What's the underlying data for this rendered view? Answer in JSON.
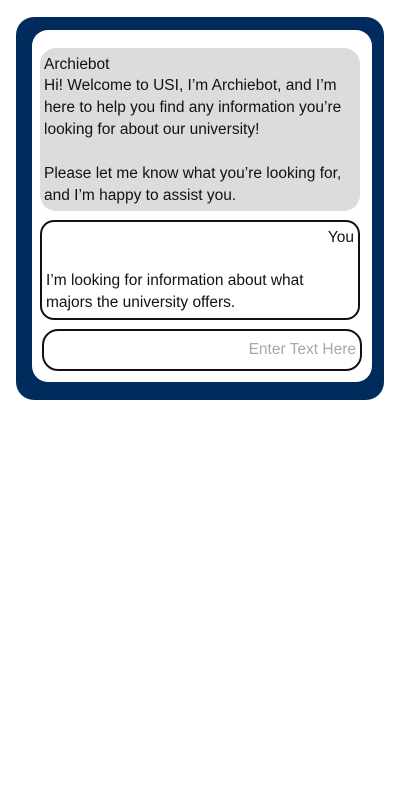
{
  "colors": {
    "frame": "#002b5c",
    "bot_bubble": "#dcdcdc",
    "panel": "#ffffff",
    "placeholder": "#a8a8a8"
  },
  "bot": {
    "name": "Archiebot",
    "messages": [
      "Hi! Welcome to USI, I’m Archiebot, and I’m here to help you find any information you’re looking for about our university!",
      "Please let me know what you’re looking for, and I’m happy to assist you."
    ]
  },
  "user": {
    "name": "You",
    "message": "I’m looking for information about what majors the university offers."
  },
  "input": {
    "placeholder": "Enter Text Here",
    "value": ""
  }
}
